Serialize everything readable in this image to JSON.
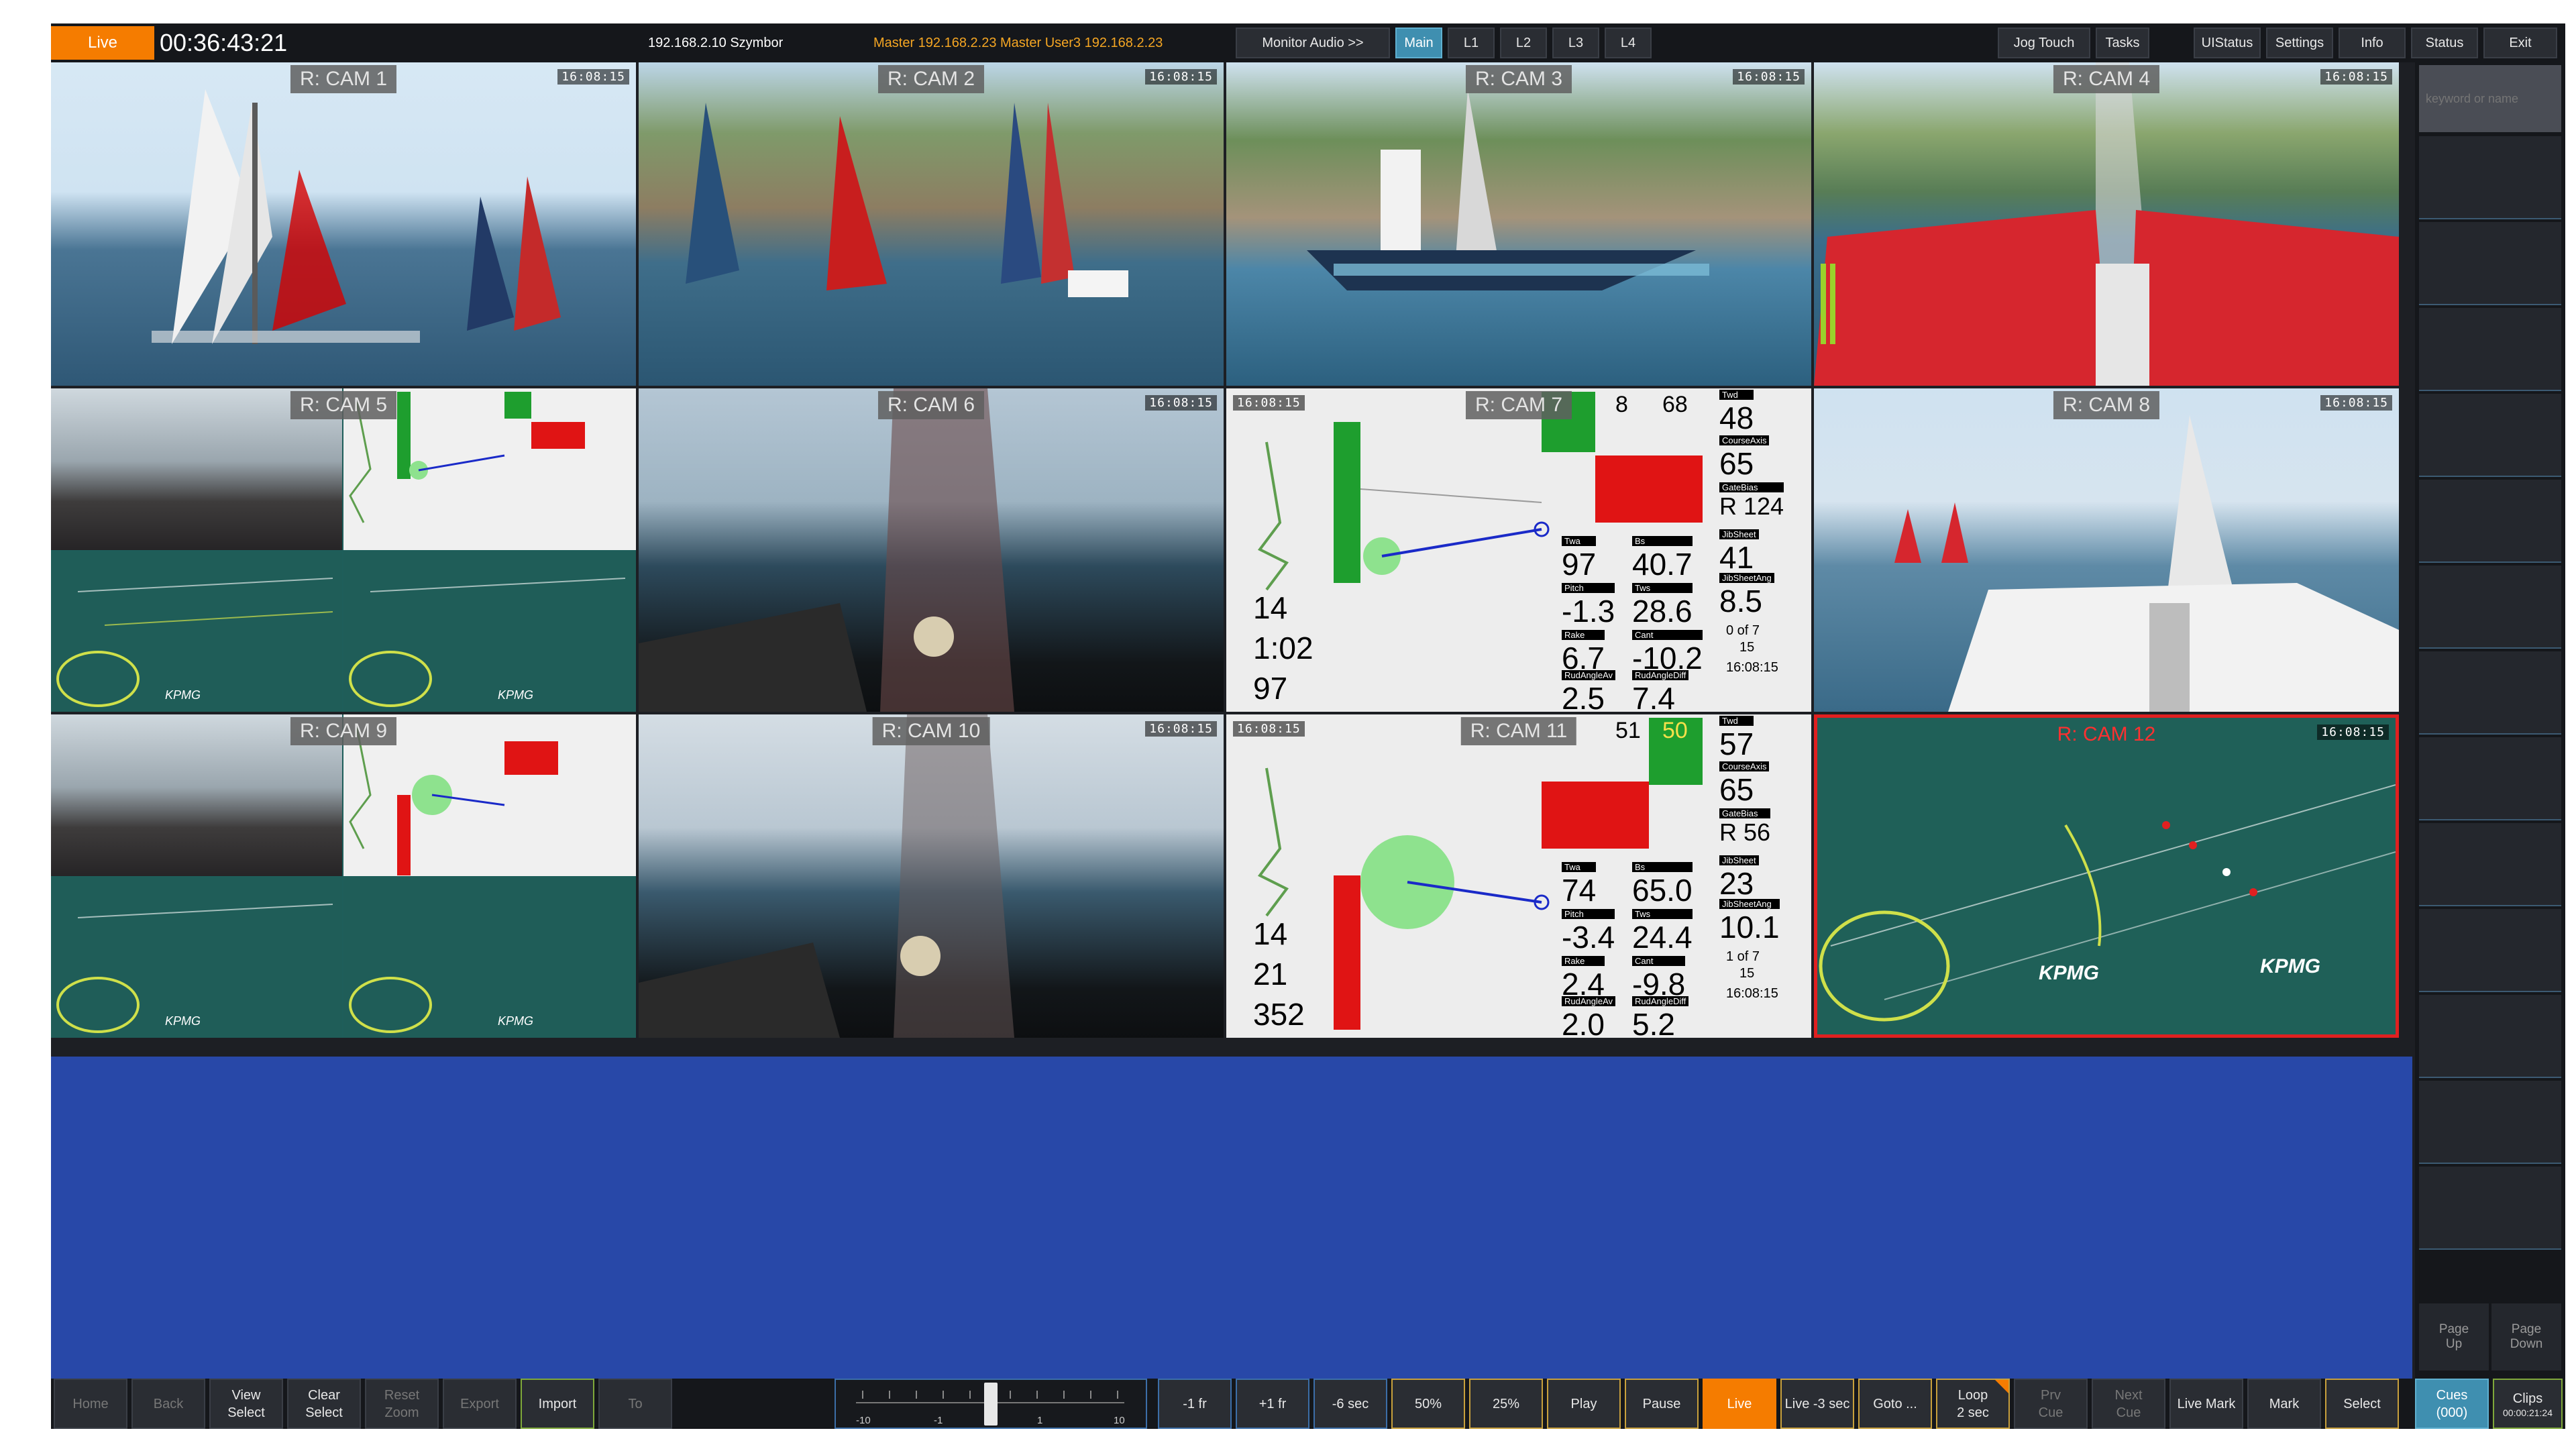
{
  "top_bar": {
    "live_label": "Live",
    "timecode": "00:36:43:21",
    "server_info": "192.168.2.10 Szymbor",
    "master_info": "Master 192.168.2.23   Master   User3   192.168.2.23",
    "monitor_audio_label": "Monitor Audio >>",
    "channels": [
      "Main",
      "L1",
      "L2",
      "L3",
      "L4"
    ],
    "jog_touch_label": "Jog Touch",
    "tasks_label": "Tasks",
    "uistatus_label": "UIStatus",
    "settings_label": "Settings",
    "info_label": "Info",
    "status_label": "Status",
    "exit_label": "Exit"
  },
  "cameras": [
    {
      "label": "R: CAM 1",
      "tc": "16:08:15"
    },
    {
      "label": "R: CAM 2",
      "tc": "16:08:15"
    },
    {
      "label": "R: CAM 3",
      "tc": "16:08:15"
    },
    {
      "label": "R: CAM 4",
      "tc": "16:08:15"
    },
    {
      "label": "R: CAM 5",
      "tc": "16:08:15"
    },
    {
      "label": "R: CAM 6",
      "tc": "16:08:15"
    },
    {
      "label": "R: CAM 7",
      "tc": "16:08:15"
    },
    {
      "label": "R: CAM 8",
      "tc": "16:08:15"
    },
    {
      "label": "R: CAM 9",
      "tc": "16:08:15"
    },
    {
      "label": "R: CAM 10",
      "tc": "16:08:15"
    },
    {
      "label": "R: CAM 11",
      "tc": "16:08:15"
    },
    {
      "label": "R: CAM 12",
      "tc": "16:08:15"
    }
  ],
  "telemetry_cam7": {
    "twd": "48",
    "course_axis": "65",
    "gate_bias": "R 124",
    "jib_sheet": "41",
    "jib_sheet_ang": "8.5",
    "pos": "0 of 7",
    "lap": "15",
    "clock": "16:08:15",
    "twa": "97",
    "bs": "40.7",
    "pitch": "-1.3",
    "tws": "28.6",
    "rake": "6.7",
    "cant": "-10.2",
    "rud_angle": "2.5",
    "rud_diff": "7.4",
    "left_a": "14",
    "left_b": "1:02",
    "left_c": "97",
    "top_a": "8",
    "top_b": "68"
  },
  "telemetry_cam11": {
    "twd": "57",
    "course_axis": "65",
    "gate_bias": "R 56",
    "jib_sheet": "23",
    "jib_sheet_ang": "10.1",
    "pos": "1 of 7",
    "lap": "15",
    "clock": "16:08:15",
    "twa": "74",
    "bs": "65.0",
    "pitch": "-3.4",
    "tws": "24.4",
    "rake": "2.4",
    "cant": "-9.8",
    "rud_angle": "2.0",
    "rud_diff": "5.2",
    "left_a": "14",
    "left_b": "21",
    "left_c": "352",
    "top_a": "51",
    "top_b": "50"
  },
  "right_panel": {
    "search_placeholder": "keyword or name",
    "page_up_label": "Page\nUp",
    "page_down_label": "Page\nDown"
  },
  "bottom_bar": {
    "home": "Home",
    "back": "Back",
    "view_select": "View\nSelect",
    "clear_select": "Clear\nSelect",
    "reset_zoom": "Reset\nZoom",
    "export": "Export",
    "import": "Import",
    "to": "To",
    "jog_scale": [
      "-10",
      "-1",
      "1",
      "10"
    ],
    "minus_1fr": "-1 fr",
    "plus_1fr": "+1 fr",
    "minus_6sec": "-6 sec",
    "speed_50": "50%",
    "speed_25": "25%",
    "play": "Play",
    "pause": "Pause",
    "live": "Live",
    "live_minus_3": "Live -3 sec",
    "goto": "Goto ...",
    "loop": "Loop\n2 sec",
    "prv_cue": "Prv\nCue",
    "next_cue": "Next\nCue",
    "live_mark": "Live Mark",
    "mark": "Mark",
    "select": "Select",
    "cues": "Cues\n(000)",
    "clips": "Clips",
    "clips_tc": "00:00:21:24"
  },
  "colors": {
    "accent_orange": "#f57c00",
    "accent_cyan": "#3f8fb0",
    "blue_area": "#2848a8",
    "selected_red": "#e02020",
    "telemetry_green": "#1e9e2e",
    "telemetry_red": "#e01414"
  }
}
